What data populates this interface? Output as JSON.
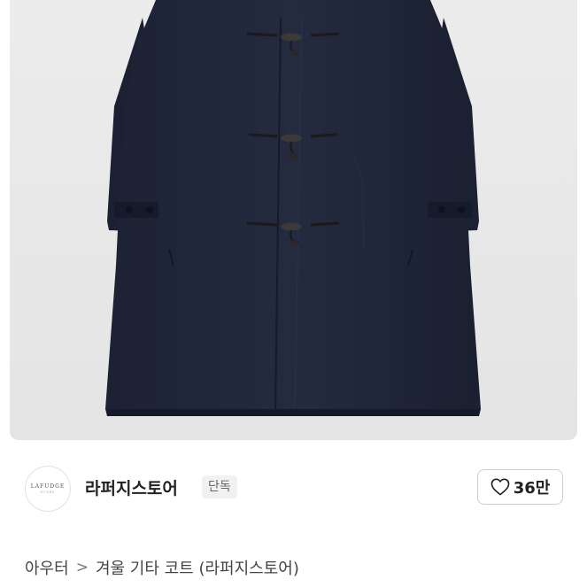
{
  "product": {
    "image_icon": "coat-photo"
  },
  "store": {
    "logo_text": "LAFUDGE",
    "logo_subtext": "STORE",
    "name": "라퍼지스토어",
    "badge": "단독"
  },
  "like": {
    "icon": "heart-outline-icon",
    "count": "36만"
  },
  "breadcrumb": {
    "category": "아우터",
    "separator": ">",
    "title": "겨울 기타 코트 (라퍼지스토어)"
  }
}
